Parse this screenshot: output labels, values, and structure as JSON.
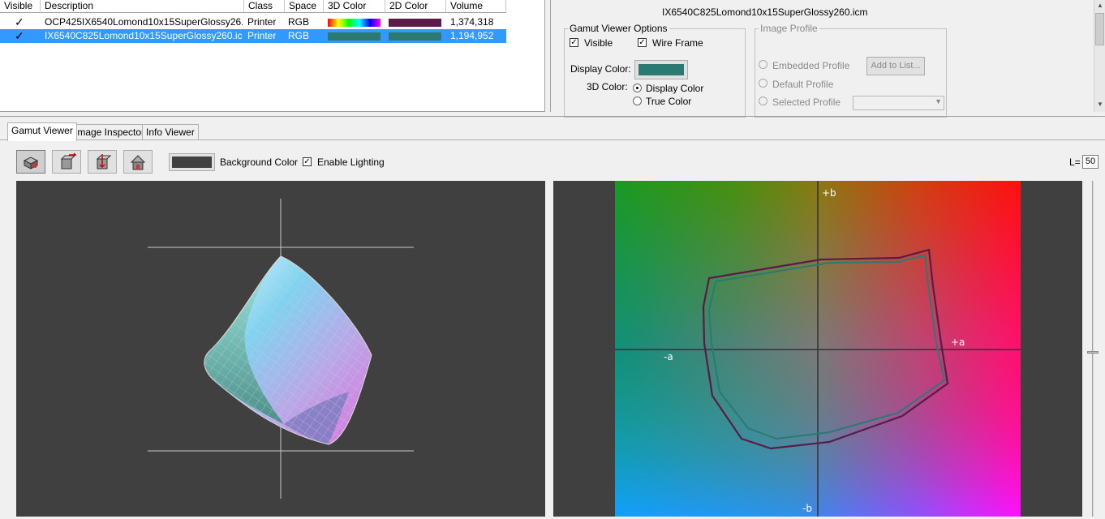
{
  "table": {
    "headers": [
      "Visible",
      "Description",
      "Class",
      "Space",
      "3D Color",
      "2D Color",
      "Volume"
    ],
    "rows": [
      {
        "visible": "✓",
        "description": "OCP425IX6540Lomond10x15SuperGlossy26...",
        "class": "Printer",
        "space": "RGB",
        "color3d": "rainbow",
        "color2d": "#5c1a48",
        "volume": "1,374,318",
        "selected": false
      },
      {
        "visible": "✓",
        "description": "IX6540C825Lomond10x15SuperGlossy260.ic...",
        "class": "Printer",
        "space": "RGB",
        "color3d": "#2a7a72",
        "color2d": "#2a7a72",
        "volume": "1,194,952",
        "selected": true
      }
    ]
  },
  "options": {
    "profile_name": "IX6540C825Lomond10x15SuperGlossy260.icm",
    "gamut_group": {
      "title": "Gamut Viewer Options",
      "visible_label": "Visible",
      "visible_checked": true,
      "wireframe_label": "Wire Frame",
      "wireframe_checked": true,
      "display_color_label": "Display Color:",
      "display_color": "#2a7a72",
      "color3d_label": "3D Color:",
      "radio_display_color": "Display Color",
      "radio_true_color": "True Color"
    },
    "image_profile_group": {
      "title": "Image Profile",
      "embedded": "Embedded Profile",
      "default": "Default Profile",
      "selected": "Selected Profile",
      "add_button": "Add to List..."
    }
  },
  "tabs": [
    "Gamut Viewer",
    "Image Inspector",
    "Info Viewer"
  ],
  "active_tab": "Gamut Viewer",
  "toolbar": {
    "background_label": "Background Color",
    "background_color": "#404040",
    "lighting_label": "Enable Lighting",
    "lighting_checked": true,
    "l_label": "L=",
    "l_value": "50"
  },
  "plot2d": {
    "pos_b": "+b",
    "neg_b": "-b",
    "pos_a": "+a",
    "neg_a": "-a"
  },
  "icons": [
    "cube-view-icon",
    "rotate-right-icon",
    "rotate-down-icon",
    "home-view-icon"
  ]
}
